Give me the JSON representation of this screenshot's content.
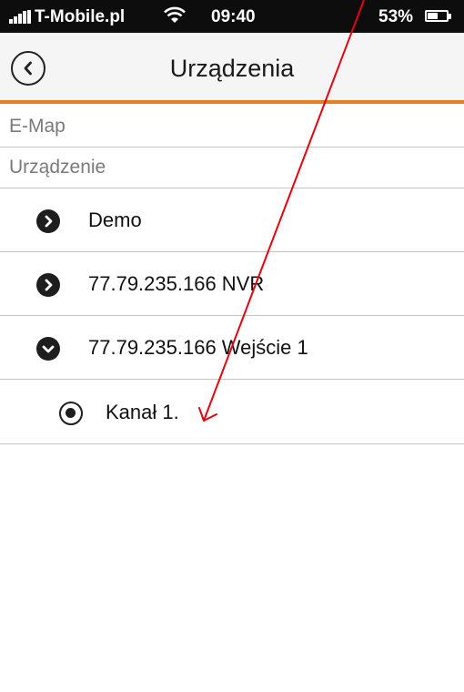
{
  "status_bar": {
    "carrier": "T-Mobile.pl",
    "time": "09:40",
    "battery_percent": "53%",
    "battery_level": 0.53,
    "signal_icon": "signal-bars-icon",
    "wifi_icon": "wifi-icon",
    "battery_icon": "battery-icon"
  },
  "header": {
    "title": "Urządzenia",
    "back_icon": "chevron-left-circle-icon",
    "accent_color": "#e67e22"
  },
  "sections": {
    "emap": "E-Map",
    "devices": "Urządzenie"
  },
  "devices": [
    {
      "label": "Demo",
      "icon": "chevron-right-circle-icon"
    },
    {
      "label": "77.79.235.166 NVR",
      "icon": "chevron-right-circle-icon"
    },
    {
      "label": "77.79.235.166 Wejście 1",
      "icon": "chevron-down-circle-icon"
    }
  ],
  "channel": {
    "label": "Kanał 1.",
    "icon": "radio-selected-icon"
  },
  "annotation": {
    "color": "#e8000d",
    "icon": "arrow-annotation"
  }
}
